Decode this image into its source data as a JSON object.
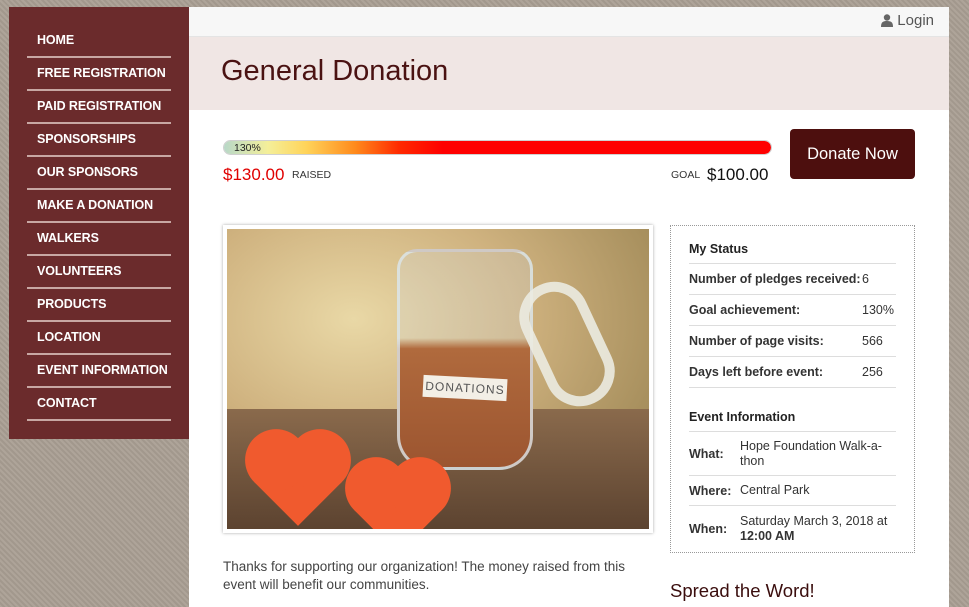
{
  "nav": {
    "items": [
      {
        "label": "HOME"
      },
      {
        "label": "FREE REGISTRATION"
      },
      {
        "label": "PAID REGISTRATION"
      },
      {
        "label": "SPONSORSHIPS"
      },
      {
        "label": "OUR SPONSORS"
      },
      {
        "label": "MAKE A DONATION"
      },
      {
        "label": "WALKERS"
      },
      {
        "label": "VOLUNTEERS"
      },
      {
        "label": "PRODUCTS"
      },
      {
        "label": "LOCATION"
      },
      {
        "label": "EVENT INFORMATION"
      },
      {
        "label": "CONTACT"
      }
    ]
  },
  "topbar": {
    "login_label": "Login",
    "login_icon": "user-icon"
  },
  "header": {
    "title": "General Donation"
  },
  "progress": {
    "percent_label": "130%",
    "fill_fraction": 1.0,
    "raised_amount": "$130.00",
    "raised_label": "RAISED",
    "goal_label": "GOAL",
    "goal_amount": "$100.00"
  },
  "donate": {
    "label": "Donate Now"
  },
  "photo": {
    "jar_label": "DONATIONS"
  },
  "body": {
    "text": "Thanks for supporting our organization! The money raised from this event will benefit our communities."
  },
  "status": {
    "heading": "My Status",
    "rows": [
      {
        "label": "Number of pledges received:",
        "value": "6"
      },
      {
        "label": "Goal achievement:",
        "value": "130%"
      },
      {
        "label": "Number of page visits:",
        "value": "566"
      },
      {
        "label": "Days left before event:",
        "value": "256"
      }
    ]
  },
  "event": {
    "heading": "Event Information",
    "what_label": "What:",
    "what_value": "Hope Foundation Walk-a-thon",
    "where_label": "Where:",
    "where_value": "Central Park",
    "when_label": "When:",
    "when_date": "Saturday March 3, 2018 at",
    "when_time": "12:00 AM"
  },
  "spread": {
    "title": "Spread the Word!"
  },
  "colors": {
    "sidebar": "#6b2b2c",
    "button": "#4d0f0e",
    "raised": "#e00000",
    "title": "#4a1212"
  }
}
